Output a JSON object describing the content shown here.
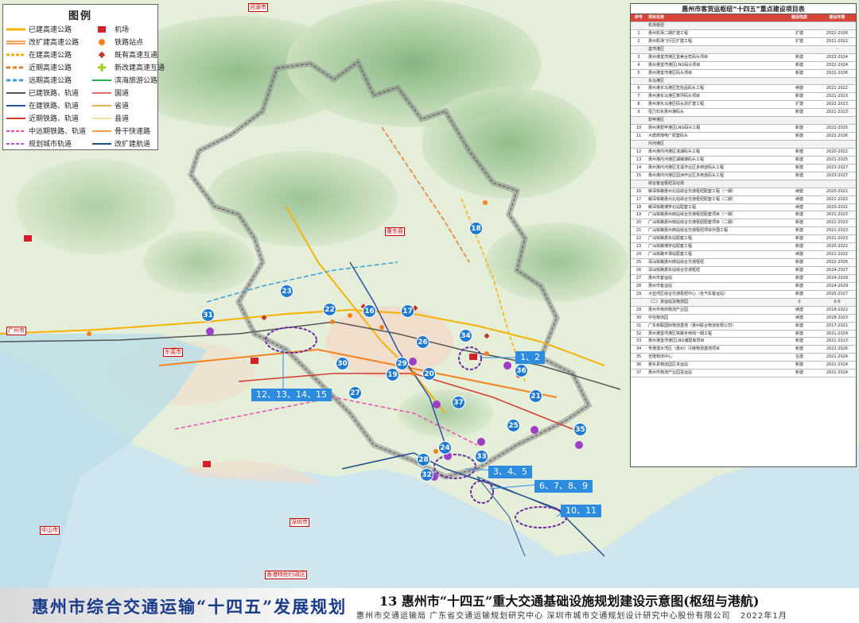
{
  "legend": {
    "title": "图例",
    "items": [
      {
        "label": "已建高速公路",
        "icon": "built-expressway",
        "color": "#f5b200"
      },
      {
        "label": "机场",
        "icon": "airport",
        "color": "#d4202a"
      },
      {
        "label": "改扩建高速公路",
        "icon": "expand-expressway",
        "color": "#f58220"
      },
      {
        "label": "铁路站点",
        "icon": "rail-station",
        "color": "#f58220"
      },
      {
        "label": "在建高速公路",
        "icon": "building-expressway",
        "color": "#f5b200"
      },
      {
        "label": "既有高速互通",
        "icon": "existing-interchange",
        "color": "#c0392b"
      },
      {
        "label": "近期高速公路",
        "icon": "nearterm-expressway",
        "color": "#e67e22"
      },
      {
        "label": "新改建高速互通",
        "icon": "new-interchange",
        "color": "#9bd11a"
      },
      {
        "label": "远期高速公路",
        "icon": "longterm-expressway",
        "color": "#3aa0d8"
      },
      {
        "label": "滨海旅游公路",
        "icon": "coastal-road",
        "color": "#2eaa4a"
      },
      {
        "label": "已建铁路、轨道",
        "icon": "built-rail",
        "color": "#555555"
      },
      {
        "label": "国道",
        "icon": "national-road",
        "color": "#e07070"
      },
      {
        "label": "在建铁路、轨道",
        "icon": "building-rail",
        "color": "#2b4fa8"
      },
      {
        "label": "省道",
        "icon": "provincial-road",
        "color": "#e8b04b"
      },
      {
        "label": "近期铁路、轨道",
        "icon": "nearterm-rail",
        "color": "#d63a2f"
      },
      {
        "label": "县道",
        "icon": "county-road",
        "color": "#f0e0a0"
      },
      {
        "label": "中远期铁路、轨道",
        "icon": "longterm-rail",
        "color": "#e94db0"
      },
      {
        "label": "骨干快速路",
        "icon": "arterial-road",
        "color": "#f0a050"
      },
      {
        "label": "规划城市轨道",
        "icon": "planned-metro",
        "color": "#b05ac8"
      },
      {
        "label": "改扩建航道",
        "icon": "waterway",
        "color": "#1f4e8c"
      }
    ]
  },
  "markers": [
    "18",
    "23",
    "22",
    "16",
    "17",
    "31",
    "34",
    "26",
    "30",
    "29",
    "19",
    "20",
    "36",
    "27",
    "21",
    "37",
    "25",
    "35",
    "24",
    "28",
    "33",
    "32"
  ],
  "callouts": [
    "1、2",
    "12、13、14、15",
    "3、4、5",
    "6、7、8、9",
    "10、11"
  ],
  "places": [
    "惠东县",
    "河源市",
    "广州市",
    "东莞市",
    "深圳市",
    "中山市",
    "香港特别行政区"
  ],
  "table": {
    "title": "惠州市客货运枢纽“十四五”重点建设项目表",
    "headers": [
      "序号",
      "项目名称",
      "建设性质",
      "建设年限"
    ],
    "rows": [
      {
        "t": "s",
        "no": "",
        "name": "机场枢纽",
        "nature": "",
        "years": ""
      },
      {
        "no": "1",
        "name": "惠州机场二期扩建工程",
        "nature": "扩建",
        "years": "2022-2026"
      },
      {
        "no": "2",
        "name": "惠州机场飞行区扩建工程",
        "nature": "扩建",
        "years": "2021-2022"
      },
      {
        "t": "s",
        "no": "",
        "name": "荃湾港区",
        "nature": "",
        "years": "-"
      },
      {
        "no": "3",
        "name": "惠州港荃湾港区荃美台危码头项目",
        "nature": "新建",
        "years": "2022-2024"
      },
      {
        "no": "4",
        "name": "惠州港荃湾港区LNG码头项目",
        "nature": "新建",
        "years": "2022-2024"
      },
      {
        "no": "5",
        "name": "惠州港荃湾港区码头项目",
        "nature": "新建",
        "years": "2022-2026"
      },
      {
        "t": "s",
        "no": "",
        "name": "东马港区",
        "nature": "",
        "years": ""
      },
      {
        "no": "6",
        "name": "惠州港东马港区危险品码头工程",
        "nature": "续建",
        "years": "2021-2022"
      },
      {
        "no": "7",
        "name": "惠州港东马港区算坪码头项目",
        "nature": "新建",
        "years": "2021-2023"
      },
      {
        "no": "8",
        "name": "惠州港东马港区码头改扩建工程",
        "nature": "扩建",
        "years": "2022-2023"
      },
      {
        "no": "9",
        "name": "恒力石化惠州港码头",
        "nature": "新建",
        "years": "2021-2023"
      },
      {
        "t": "s",
        "no": "",
        "name": "碧甲港区",
        "nature": "",
        "years": ""
      },
      {
        "no": "10",
        "name": "惠州港碧甲港区LNG码头工程",
        "nature": "新建",
        "years": "2021-2025"
      },
      {
        "no": "11",
        "name": "大唐燃煤电厂配套码头",
        "nature": "新建",
        "years": "2022-2026"
      },
      {
        "t": "s",
        "no": "",
        "name": "内河港区",
        "nature": "",
        "years": ""
      },
      {
        "no": "12",
        "name": "惠州港内河港区潼湖码头工程",
        "nature": "新建",
        "years": "2020-2022"
      },
      {
        "no": "13",
        "name": "惠州港内河港区湖镇港码头工程",
        "nature": "新建",
        "years": "2021-2025"
      },
      {
        "no": "14",
        "name": "惠州港内河港区龙溪作业区多用途码头工程",
        "nature": "新建",
        "years": "2023-2027"
      },
      {
        "no": "15",
        "name": "惠州港内河港区园洲作业区多用途码头工程",
        "nature": "新建",
        "years": "2023-2027"
      },
      {
        "t": "s",
        "no": "",
        "name": "综合客运枢纽及站场",
        "nature": "",
        "years": ""
      },
      {
        "no": "16",
        "name": "赣深铁路惠州北站综合交通枢纽配套工程（一期）",
        "nature": "续建",
        "years": "2020-2021"
      },
      {
        "no": "17",
        "name": "赣深铁路惠州北站综合交通枢纽配套工程（二期）",
        "nature": "续建",
        "years": "2021-2022"
      },
      {
        "no": "18",
        "name": "赣深铁路博罗北站配套工程",
        "nature": "续建",
        "years": "2020-2021"
      },
      {
        "no": "19",
        "name": "广汕铁路惠州南站综合交通枢纽配套项目（一期）",
        "nature": "新建",
        "years": "2021-2023"
      },
      {
        "no": "20",
        "name": "广汕铁路惠州南站综合交通枢纽配套项目（二期）",
        "nature": "新建",
        "years": "2021-2023"
      },
      {
        "no": "21",
        "name": "广汕铁路惠州南站综合交通枢纽项目外围工程",
        "nature": "新建",
        "years": "2021-2023"
      },
      {
        "no": "22",
        "name": "广汕铁路惠东站配套工程",
        "nature": "新建",
        "years": "2021-2023"
      },
      {
        "no": "23",
        "name": "广汕铁路博罗站配套工程",
        "nature": "新建",
        "years": "2020-2022"
      },
      {
        "no": "24",
        "name": "广汕铁路平潭站配套工程",
        "nature": "续建",
        "years": "2021-2022"
      },
      {
        "no": "25",
        "name": "深汕铁路惠州南站综合交通枢纽",
        "nature": "新建",
        "years": "2022-2026"
      },
      {
        "no": "26",
        "name": "深汕铁路惠东站综合交通枢纽",
        "nature": "新建",
        "years": "2024-2027"
      },
      {
        "no": "27",
        "name": "惠州市客运站",
        "nature": "新建",
        "years": "2024-2029"
      },
      {
        "no": "28",
        "name": "惠州市客运站",
        "nature": "新建",
        "years": "2024-2029"
      },
      {
        "no": "29",
        "name": "大亚湾区综合交通枢纽中心（含汽车客运站）",
        "nature": "新建",
        "years": "2025-2027"
      },
      {
        "t": "s",
        "no": "",
        "name": "（二）货运站及物流园",
        "nature": "0",
        "years": "0-0"
      },
      {
        "no": "29",
        "name": "惠州市电商物流产业园",
        "nature": "续建",
        "years": "2018-2022"
      },
      {
        "no": "30",
        "name": "中信物流园",
        "nature": "续建",
        "years": "2018-2023"
      },
      {
        "no": "31",
        "name": "广东桥联国际物流基地（惠州联合物流有限公司）",
        "nature": "新建",
        "years": "2017-2021"
      },
      {
        "no": "32",
        "name": "惠州港荃湾港区铁路专用线一期工程",
        "nature": "新建",
        "years": "2021-2024"
      },
      {
        "no": "33",
        "name": "惠州港荃湾港区LNG储配库项目",
        "nature": "新建",
        "years": "2021-2023"
      },
      {
        "no": "34",
        "name": "粤港澳大湾区（惠州）冷链物流基地项目",
        "nature": "新建",
        "years": "2022-2026"
      },
      {
        "no": "35",
        "name": "吉隆物流中心",
        "nature": "在建",
        "years": "2021-2024"
      },
      {
        "no": "36",
        "name": "惠东县物流园区货运站",
        "nature": "新建",
        "years": "2021-2024"
      },
      {
        "no": "37",
        "name": "惠州市物流产业园货运站",
        "nature": "新建",
        "years": "2021-2024"
      }
    ]
  },
  "footer": {
    "left_title": "惠州市综合交通运输“十四五”发展规划",
    "figure_title": "13  惠州市“十四五”重大交通基础设施规划建设示意图(枢纽与港航)",
    "orgs": "惠州市交通运输局   广东省交通运输规划研究中心   深圳市城市交通规划设计研究中心股份有限公司",
    "date": "2022年1月"
  }
}
